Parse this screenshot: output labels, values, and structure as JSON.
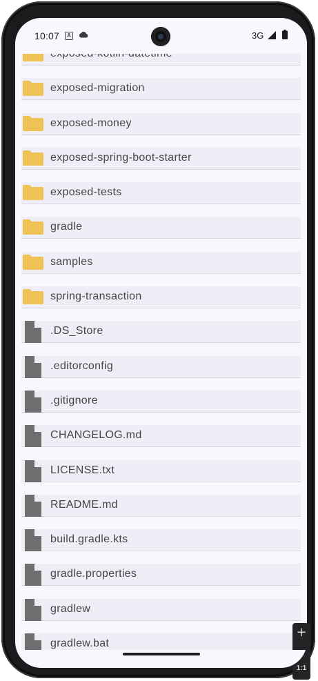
{
  "status_bar": {
    "time": "10:07",
    "network": "3G"
  },
  "files": [
    {
      "name": "exposed-kotlin-datetime",
      "type": "folder"
    },
    {
      "name": "exposed-migration",
      "type": "folder"
    },
    {
      "name": "exposed-money",
      "type": "folder"
    },
    {
      "name": "exposed-spring-boot-starter",
      "type": "folder"
    },
    {
      "name": "exposed-tests",
      "type": "folder"
    },
    {
      "name": "gradle",
      "type": "folder"
    },
    {
      "name": "samples",
      "type": "folder"
    },
    {
      "name": "spring-transaction",
      "type": "folder"
    },
    {
      "name": ".DS_Store",
      "type": "file"
    },
    {
      "name": ".editorconfig",
      "type": "file"
    },
    {
      "name": ".gitignore",
      "type": "file"
    },
    {
      "name": "CHANGELOG.md",
      "type": "file"
    },
    {
      "name": "LICENSE.txt",
      "type": "file"
    },
    {
      "name": "README.md",
      "type": "file"
    },
    {
      "name": "build.gradle.kts",
      "type": "file"
    },
    {
      "name": "gradle.properties",
      "type": "file"
    },
    {
      "name": "gradlew",
      "type": "file"
    },
    {
      "name": "gradlew.bat",
      "type": "file"
    }
  ],
  "colors": {
    "folder": "#efc353",
    "file": "#6e6e6e",
    "row_bg": "#efedf6"
  },
  "emulator_zoom": {
    "plus_label": "+",
    "ratio_label": "1:1"
  }
}
